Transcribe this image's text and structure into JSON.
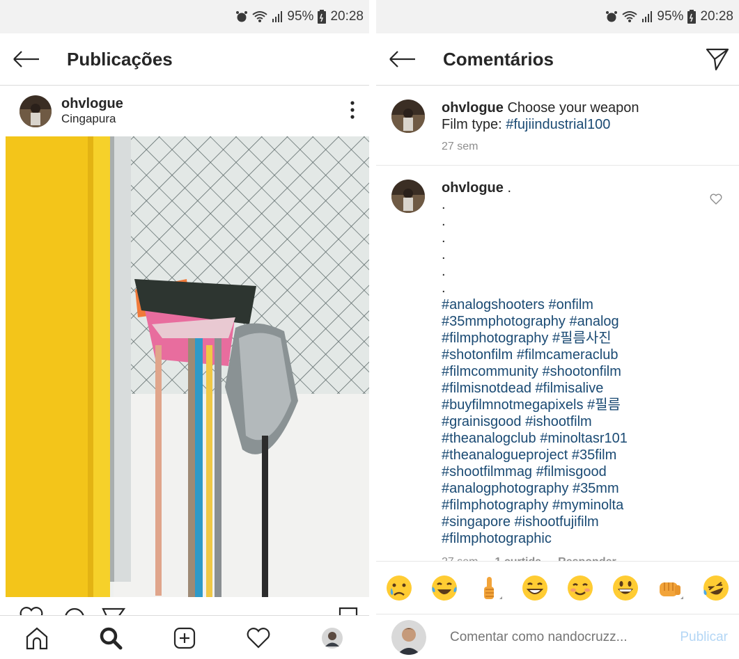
{
  "status_bar": {
    "battery": "95%",
    "time": "20:28"
  },
  "left": {
    "header_title": "Publicações",
    "post": {
      "username": "ohvlogue",
      "location": "Cingapura"
    }
  },
  "right": {
    "header_title": "Comentários",
    "caption": {
      "username": "ohvlogue",
      "text": "Choose your weapon",
      "film_label": "Film type:",
      "film_tag": "#fujiindustrial100",
      "time": "27 sem"
    },
    "comment": {
      "username": "ohvlogue",
      "first_dot": ".",
      "dots": [
        ".",
        ".",
        ".",
        ".",
        ".",
        "."
      ],
      "hashtag_lines": [
        "#analogshooters #onfilm",
        "#35mmphotography #analog",
        "#filmphotography #필름사진",
        "#shotonfilm #filmcameraclub",
        "#filmcommunity #shootonfilm",
        "#filmisnotdead #filmisalive",
        "#buyfilmnotmegapixels #필름",
        "#grainisgood #ishootfilm",
        "#theanalogclub #minoltasr101",
        "#theanalogueproject #35film",
        "#shootfilmmag #filmisgood",
        "#analogphotography #35mm",
        "#filmphotography #myminolta",
        "#singapore #ishootfujifilm",
        "#filmphotographic"
      ],
      "time": "27 sem",
      "likes": "1 curtida",
      "reply": "Responder"
    },
    "compose": {
      "placeholder": "Comentar como nandocruzz...",
      "publish": "Publicar"
    },
    "emojis": [
      "crying-face",
      "tears-of-joy",
      "thumbs-up",
      "grinning-squint",
      "smiling-face",
      "grinning-face",
      "fist-bump",
      "rofl"
    ]
  }
}
